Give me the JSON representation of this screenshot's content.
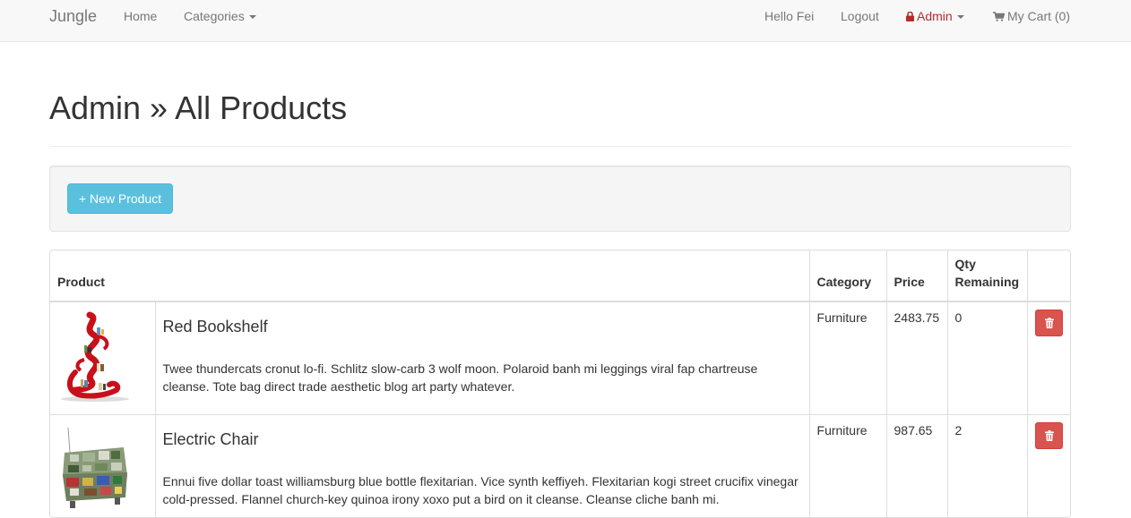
{
  "navbar": {
    "brand": "Jungle",
    "home": "Home",
    "categories": "Categories",
    "greeting": "Hello Fei",
    "logout": "Logout",
    "admin": "Admin",
    "cart": "My Cart (0)"
  },
  "page": {
    "title": "Admin » All Products",
    "new_product_button": "+ New Product"
  },
  "table": {
    "headers": {
      "product": "Product",
      "category": "Category",
      "price": "Price",
      "qty_line1": "Qty",
      "qty_line2": "Remaining"
    },
    "rows": [
      {
        "name": "Red Bookshelf",
        "description": "Twee thundercats cronut lo-fi. Schlitz slow-carb 3 wolf moon. Polaroid banh mi leggings viral fap chartreuse cleanse. Tote bag direct trade aesthetic blog art party whatever.",
        "category": "Furniture",
        "price": "2483.75",
        "qty": "0"
      },
      {
        "name": "Electric Chair",
        "description": "Ennui five dollar toast williamsburg blue bottle flexitarian. Vice synth keffiyeh. Flexitarian kogi street crucifix vinegar cold-pressed. Flannel church-key quinoa irony xoxo put a bird on it cleanse. Cleanse cliche banh mi.",
        "category": "Furniture",
        "price": "987.65",
        "qty": "2"
      }
    ]
  },
  "colors": {
    "navbar_bg": "#f8f8f8",
    "admin_red": "#b62b2b",
    "info_button": "#5bc0de",
    "danger_button": "#d9534f"
  },
  "icons": [
    "lock-icon",
    "cart-icon",
    "trash-icon",
    "caret-down-icon"
  ]
}
